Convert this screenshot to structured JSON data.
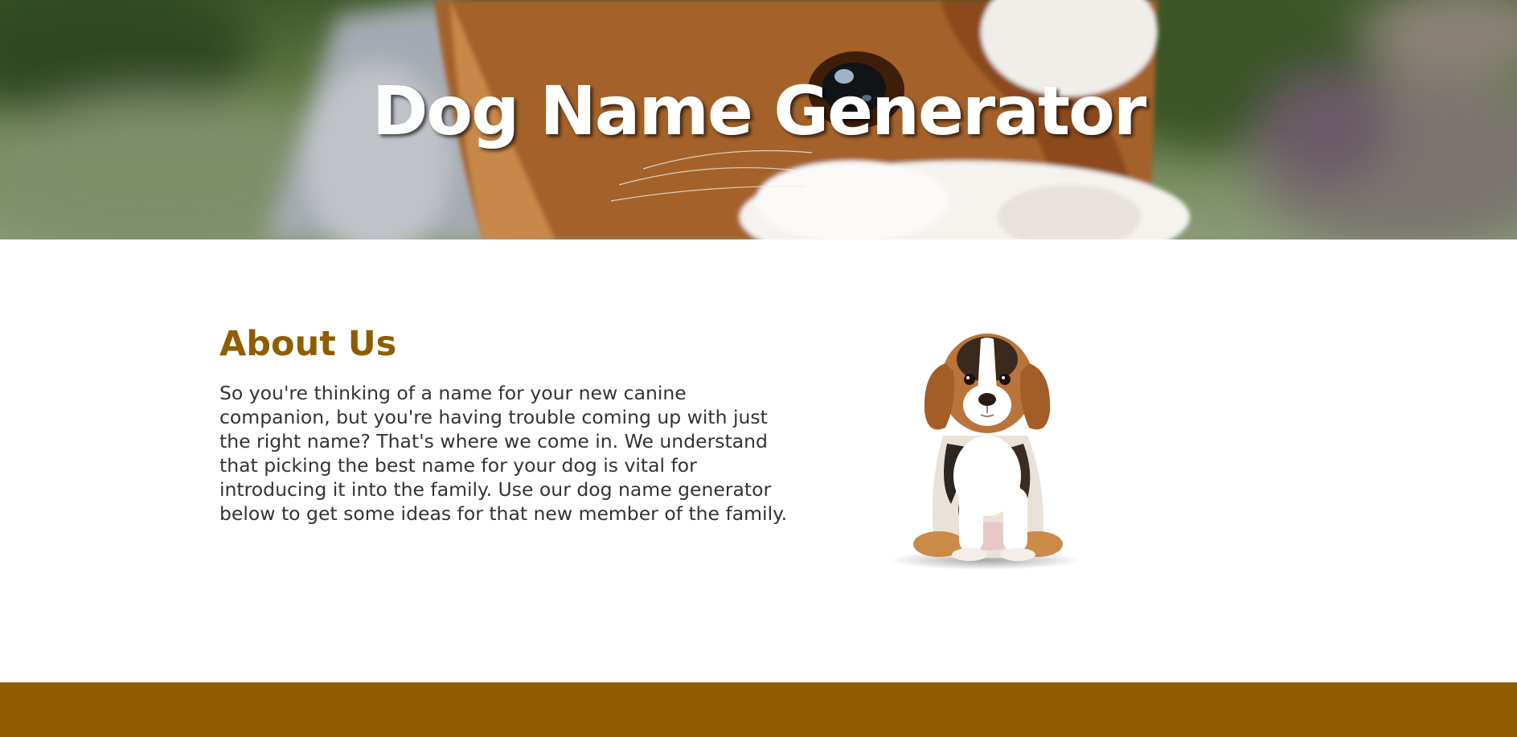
{
  "hero": {
    "title": "Dog Name Generator"
  },
  "about": {
    "heading": "About Us",
    "body": "So you're thinking of a name for your new canine companion, but you're having trouble coming up with just the right name? That's where we come in. We understand that picking the best name for your dog is vital for introducing it into the family. Use our dog name generator below to get some ideas for that new member of the family."
  },
  "theme": {
    "accent": "#8f5d00",
    "text": "#333333",
    "hero_text": "#ffffff",
    "background": "#ffffff"
  }
}
